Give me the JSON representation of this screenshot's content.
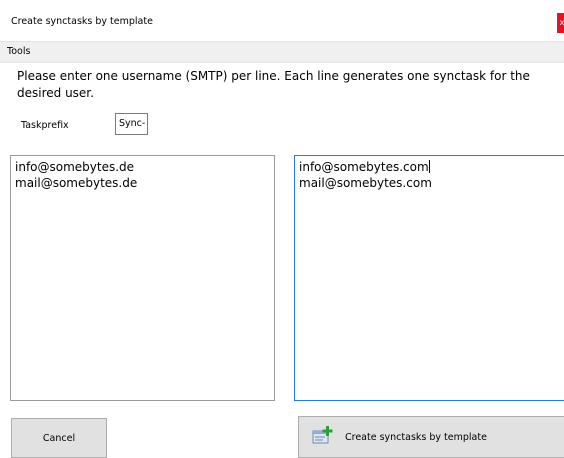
{
  "window": {
    "title": "Create synctasks by template",
    "close_glyph": "x"
  },
  "menu": {
    "items": [
      "Tools"
    ]
  },
  "instructions": "Please enter one username (SMTP) per line. Each line generates one synctask for the desired user.",
  "taskprefix": {
    "label": "Taskprefix",
    "value": "Sync-"
  },
  "source_list": {
    "lines": [
      "info@somebytes.de",
      "mail@somebytes.de"
    ]
  },
  "target_list": {
    "lines": [
      "info@somebytes.com",
      "mail@somebytes.com"
    ]
  },
  "buttons": {
    "cancel": "Cancel",
    "create": "Create synctasks by template",
    "create_icon": "add-task-icon"
  },
  "colors": {
    "focus_border": "#2b79d6",
    "close_button": "#e81123",
    "button_face": "#e1e1e1",
    "menubar": "#f0f0f0"
  }
}
